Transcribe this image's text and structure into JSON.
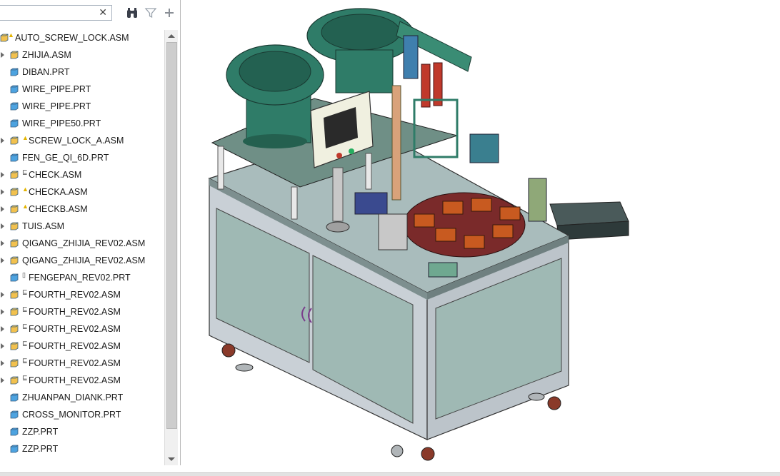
{
  "toolbar": {
    "search_placeholder": "",
    "search_value": "",
    "clear_glyph": "✕"
  },
  "tree": {
    "root": {
      "label": "AUTO_SCREW_LOCK.ASM",
      "type": "asm",
      "status": "warning"
    },
    "items": [
      {
        "label": "ZHIJIA.ASM",
        "type": "asm",
        "expandable": true,
        "status": ""
      },
      {
        "label": "DIBAN.PRT",
        "type": "prt",
        "expandable": false,
        "status": ""
      },
      {
        "label": "WIRE_PIPE.PRT",
        "type": "prt",
        "expandable": false,
        "status": ""
      },
      {
        "label": "WIRE_PIPE.PRT",
        "type": "prt",
        "expandable": false,
        "status": ""
      },
      {
        "label": "WIRE_PIPE50.PRT",
        "type": "prt",
        "expandable": false,
        "status": ""
      },
      {
        "label": "SCREW_LOCK_A.ASM",
        "type": "asm",
        "expandable": true,
        "status": "warning"
      },
      {
        "label": "FEN_GE_QI_6D.PRT",
        "type": "prt",
        "expandable": false,
        "status": ""
      },
      {
        "label": "CHECK.ASM",
        "type": "asm",
        "expandable": true,
        "status": "family"
      },
      {
        "label": "CHECKA.ASM",
        "type": "asm",
        "expandable": true,
        "status": "warning"
      },
      {
        "label": "CHECKB.ASM",
        "type": "asm",
        "expandable": true,
        "status": "warning"
      },
      {
        "label": "TUIS.ASM",
        "type": "asm",
        "expandable": true,
        "status": ""
      },
      {
        "label": "QIGANG_ZHIJIA_REV02.ASM",
        "type": "asm",
        "expandable": true,
        "status": ""
      },
      {
        "label": "QIGANG_ZHIJIA_REV02.ASM",
        "type": "asm",
        "expandable": true,
        "status": ""
      },
      {
        "label": "FENGEPAN_REV02.PRT",
        "type": "prt",
        "expandable": false,
        "status": "generic"
      },
      {
        "label": "FOURTH_REV02.ASM",
        "type": "asm",
        "expandable": true,
        "status": "family"
      },
      {
        "label": "FOURTH_REV02.ASM",
        "type": "asm",
        "expandable": true,
        "status": "family"
      },
      {
        "label": "FOURTH_REV02.ASM",
        "type": "asm",
        "expandable": true,
        "status": "family"
      },
      {
        "label": "FOURTH_REV02.ASM",
        "type": "asm",
        "expandable": true,
        "status": "family"
      },
      {
        "label": "FOURTH_REV02.ASM",
        "type": "asm",
        "expandable": true,
        "status": "family"
      },
      {
        "label": "FOURTH_REV02.ASM",
        "type": "asm",
        "expandable": true,
        "status": "family"
      },
      {
        "label": "ZHUANPAN_DIANK.PRT",
        "type": "prt",
        "expandable": false,
        "status": ""
      },
      {
        "label": "CROSS_MONITOR.PRT",
        "type": "prt",
        "expandable": false,
        "status": ""
      },
      {
        "label": "ZZP.PRT",
        "type": "prt",
        "expandable": false,
        "status": ""
      },
      {
        "label": "ZZP.PRT",
        "type": "prt",
        "expandable": false,
        "status": ""
      }
    ]
  },
  "colors": {
    "asm_icon": "#f2c14e",
    "prt_icon": "#4da3e0",
    "warning": "#e3b400",
    "machine_frame": "#c9d0d6",
    "machine_panel": "#9fb9b4",
    "bowl_green": "#2f7c68",
    "table_top": "#a9bcbc"
  },
  "icons": {
    "binoculars": "binoculars-icon",
    "filter": "filter-icon",
    "add": "plus-icon"
  }
}
